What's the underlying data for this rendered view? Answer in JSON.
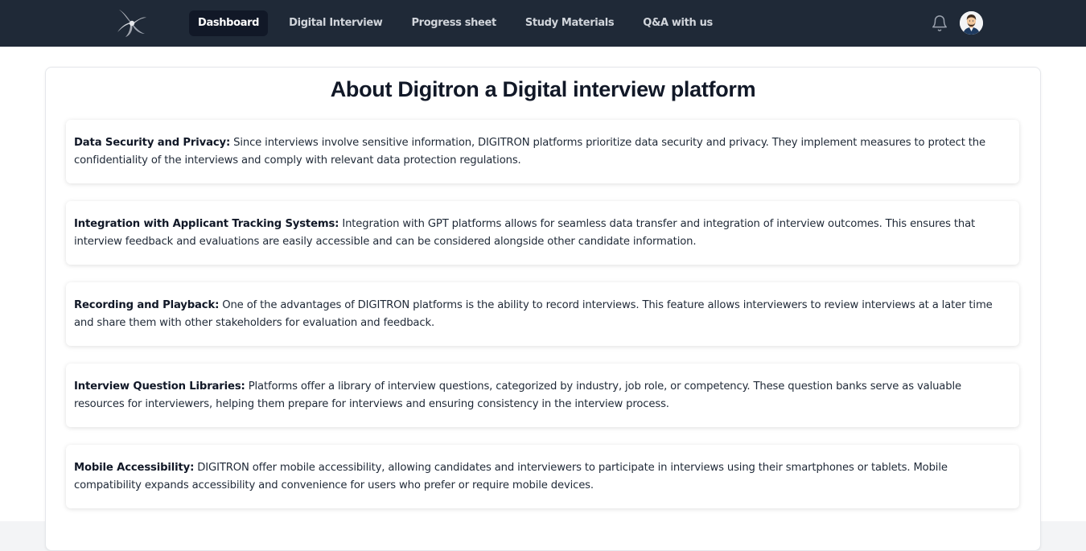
{
  "nav": {
    "items": [
      {
        "label": "Dashboard",
        "active": true
      },
      {
        "label": "Digital Interview",
        "active": false
      },
      {
        "label": "Progress sheet",
        "active": false
      },
      {
        "label": "Study Materials",
        "active": false
      },
      {
        "label": "Q&A with us",
        "active": false
      }
    ],
    "icons": {
      "logo": "swirl-logo-icon",
      "notifications": "bell-icon",
      "profile": "user-avatar"
    }
  },
  "main": {
    "title": "About Digitron a Digital interview platform",
    "sections": [
      {
        "heading": "Data Security and Privacy:",
        "text": " Since interviews involve sensitive information, DIGITRON platforms prioritize data security and privacy. They implement measures to protect the confidentiality of the interviews and comply with relevant data protection regulations."
      },
      {
        "heading": "Integration with Applicant Tracking Systems:",
        "text": " Integration with GPT platforms allows for seamless data transfer and integration of interview outcomes. This ensures that interview feedback and evaluations are easily accessible and can be considered alongside other candidate information."
      },
      {
        "heading": "Recording and Playback:",
        "text": " One of the advantages of DIGITRON platforms is the ability to record interviews. This feature allows interviewers to review interviews at a later time and share them with other stakeholders for evaluation and feedback."
      },
      {
        "heading": "Interview Question Libraries:",
        "text": " Platforms offer a library of interview questions, categorized by industry, job role, or competency. These question banks serve as valuable resources for interviewers, helping them prepare for interviews and ensuring consistency in the interview process."
      },
      {
        "heading": "Mobile Accessibility:",
        "text": " DIGITRON offer mobile accessibility, allowing candidates and interviewers to participate in interviews using their smartphones or tablets. Mobile compatibility expands accessibility and convenience for users who prefer or require mobile devices."
      }
    ]
  },
  "colors": {
    "navbar": "#1f2937",
    "active_tab": "#111827",
    "nav_text": "#d1d5db",
    "body_text": "#1f2937"
  }
}
